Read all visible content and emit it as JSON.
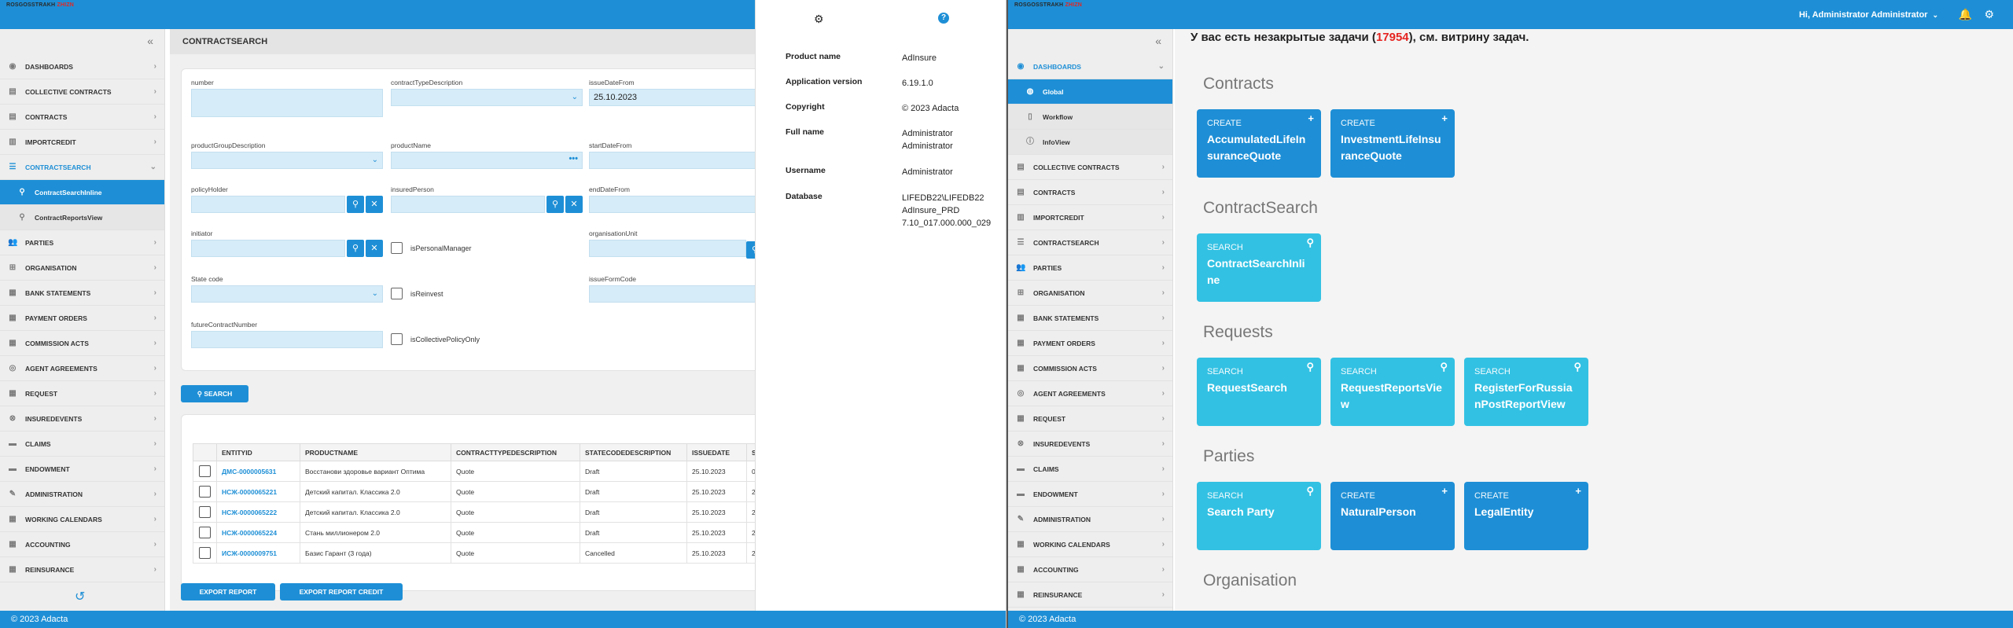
{
  "logo": {
    "part1": "ROSGOSSTRAKH",
    "part2": "ZHIZN"
  },
  "footer_text": "© 2023 Adacta",
  "left_sidebar": {
    "items": [
      {
        "label": "DASHBOARDS",
        "icon": "dashboard-icon"
      },
      {
        "label": "COLLECTIVE CONTRACTS",
        "icon": "contracts-icon"
      },
      {
        "label": "CONTRACTS",
        "icon": "contracts-icon"
      },
      {
        "label": "IMPORTCREDIT",
        "icon": "import-icon"
      },
      {
        "label": "CONTRACTSEARCH",
        "icon": "list-icon"
      },
      {
        "label": "ContractSearchInline",
        "icon": "search-icon"
      },
      {
        "label": "ContractReportsView",
        "icon": "search-icon"
      },
      {
        "label": "PARTIES",
        "icon": "users-icon"
      },
      {
        "label": "ORGANISATION",
        "icon": "org-icon"
      },
      {
        "label": "BANK STATEMENTS",
        "icon": "doc-icon"
      },
      {
        "label": "PAYMENT ORDERS",
        "icon": "doc-icon"
      },
      {
        "label": "COMMISSION ACTS",
        "icon": "doc-icon"
      },
      {
        "label": "AGENT AGREEMENTS",
        "icon": "eye-icon"
      },
      {
        "label": "REQUEST",
        "icon": "doc-icon"
      },
      {
        "label": "INSUREDEVENTS",
        "icon": "x-circle-icon"
      },
      {
        "label": "CLAIMS",
        "icon": "folder-icon"
      },
      {
        "label": "ENDOWMENT",
        "icon": "folder-icon"
      },
      {
        "label": "ADMINISTRATION",
        "icon": "edit-icon"
      },
      {
        "label": "WORKING CALENDARS",
        "icon": "calendar-icon"
      },
      {
        "label": "ACCOUNTING",
        "icon": "doc-icon"
      },
      {
        "label": "REINSURANCE",
        "icon": "doc-icon"
      }
    ]
  },
  "contract_search": {
    "title": "CONTRACTSEARCH",
    "fields": {
      "number": "number",
      "contract_type": "contractTypeDescription",
      "issue_date_from": "issueDateFrom",
      "issue_date_value": "25.10.2023",
      "product_group": "productGroupDescription",
      "product_name": "productName",
      "start_date_from": "startDateFrom",
      "policy_holder": "policyHolder",
      "insured_person": "insuredPerson",
      "end_date_from": "endDateFrom",
      "initiator": "initiator",
      "is_personal_manager": "isPersonalManager",
      "organisation_unit": "organisationUnit",
      "state_code": "State code",
      "is_reinvest": "isReinvest",
      "issue_form_code": "issueFormCode",
      "future_contract_number": "futureContractNumber",
      "is_collective_policy_only": "isCollectivePolicyOnly"
    },
    "search_button": "SEARCH",
    "table": {
      "headers": [
        "ENTITYID",
        "PRODUCTNAME",
        "CONTRACTTYPEDESCRIPTION",
        "STATECODEDESCRIPTION",
        "ISSUEDATE",
        "ST"
      ],
      "rows": [
        [
          "ДМС-0000005631",
          "Восстанови здоровье вариант Оптима",
          "Quote",
          "Draft",
          "25.10.2023",
          "08."
        ],
        [
          "НСЖ-0000065221",
          "Детский капитал. Классика 2.0",
          "Quote",
          "Draft",
          "25.10.2023",
          "29."
        ],
        [
          "НСЖ-0000065222",
          "Детский капитал. Классика 2.0",
          "Quote",
          "Draft",
          "25.10.2023",
          "29."
        ],
        [
          "НСЖ-0000065224",
          "Стань миллионером 2.0",
          "Quote",
          "Draft",
          "25.10.2023",
          "25."
        ],
        [
          "ИСЖ-0000009751",
          "Базис Гарант (3 года)",
          "Quote",
          "Cancelled",
          "25.10.2023",
          "29."
        ]
      ]
    },
    "export_report": "EXPORT REPORT",
    "export_report_credit": "EXPORT REPORT CREDIT"
  },
  "about": {
    "rows": [
      {
        "key": "Product name",
        "value": "AdInsure"
      },
      {
        "key": "Application version",
        "value": "6.19.1.0"
      },
      {
        "key": "Copyright",
        "value": "© 2023 Adacta"
      },
      {
        "key": "Full name",
        "value": "Administrator Administrator"
      },
      {
        "key": "Username",
        "value": "Administrator"
      },
      {
        "key": "Database",
        "value": "LIFEDB22\\LIFEDB22 AdInsure_PRD 7.10_017.000.000_029"
      }
    ]
  },
  "right_header": {
    "user": "Hi, Administrator Administrator"
  },
  "right_sidebar": {
    "items": [
      {
        "label": "DASHBOARDS",
        "icon": "dashboard-icon"
      },
      {
        "label": "Global",
        "icon": "globe-icon"
      },
      {
        "label": "Workflow",
        "icon": "doc-icon"
      },
      {
        "label": "InfoView",
        "icon": "info-icon"
      },
      {
        "label": "COLLECTIVE CONTRACTS",
        "icon": "contracts-icon"
      },
      {
        "label": "CONTRACTS",
        "icon": "contracts-icon"
      },
      {
        "label": "IMPORTCREDIT",
        "icon": "import-icon"
      },
      {
        "label": "CONTRACTSEARCH",
        "icon": "list-icon"
      },
      {
        "label": "PARTIES",
        "icon": "users-icon"
      },
      {
        "label": "ORGANISATION",
        "icon": "org-icon"
      },
      {
        "label": "BANK STATEMENTS",
        "icon": "doc-icon"
      },
      {
        "label": "PAYMENT ORDERS",
        "icon": "doc-icon"
      },
      {
        "label": "COMMISSION ACTS",
        "icon": "doc-icon"
      },
      {
        "label": "AGENT AGREEMENTS",
        "icon": "eye-icon"
      },
      {
        "label": "REQUEST",
        "icon": "doc-icon"
      },
      {
        "label": "INSUREDEVENTS",
        "icon": "x-circle-icon"
      },
      {
        "label": "CLAIMS",
        "icon": "folder-icon"
      },
      {
        "label": "ENDOWMENT",
        "icon": "folder-icon"
      },
      {
        "label": "ADMINISTRATION",
        "icon": "edit-icon"
      },
      {
        "label": "WORKING CALENDARS",
        "icon": "calendar-icon"
      },
      {
        "label": "ACCOUNTING",
        "icon": "doc-icon"
      },
      {
        "label": "REINSURANCE",
        "icon": "doc-icon"
      }
    ]
  },
  "dashboard": {
    "tasks_prefix": "У вас есть незакрытые задачи (",
    "tasks_count": "17954",
    "tasks_suffix": "), см. витрину задач.",
    "sections": {
      "contracts": "Contracts",
      "contract_search": "ContractSearch",
      "requests": "Requests",
      "parties": "Parties",
      "organisation": "Organisation"
    },
    "tiles": {
      "accum": {
        "kind": "CREATE",
        "name": "AccumulatedLifeInsuranceQuote"
      },
      "invest": {
        "kind": "CREATE",
        "name": "InvestmentLifeInsuranceQuote"
      },
      "csi": {
        "kind": "SEARCH",
        "name": "ContractSearchInline"
      },
      "reqsearch": {
        "kind": "SEARCH",
        "name": "RequestSearch"
      },
      "reqreports": {
        "kind": "SEARCH",
        "name": "RequestReportsView"
      },
      "register": {
        "kind": "SEARCH",
        "name": "RegisterForRussianPostReportView"
      },
      "searchparty": {
        "kind": "SEARCH",
        "name": "Search Party"
      },
      "natural": {
        "kind": "CREATE",
        "name": "NaturalPerson"
      },
      "legal": {
        "kind": "CREATE",
        "name": "LegalEntity"
      }
    }
  },
  "colors": {
    "primary": "#1e8fd6",
    "tile_search": "#33c1e3",
    "accent_red": "#e52521",
    "field_bg": "#d6ecf8"
  }
}
